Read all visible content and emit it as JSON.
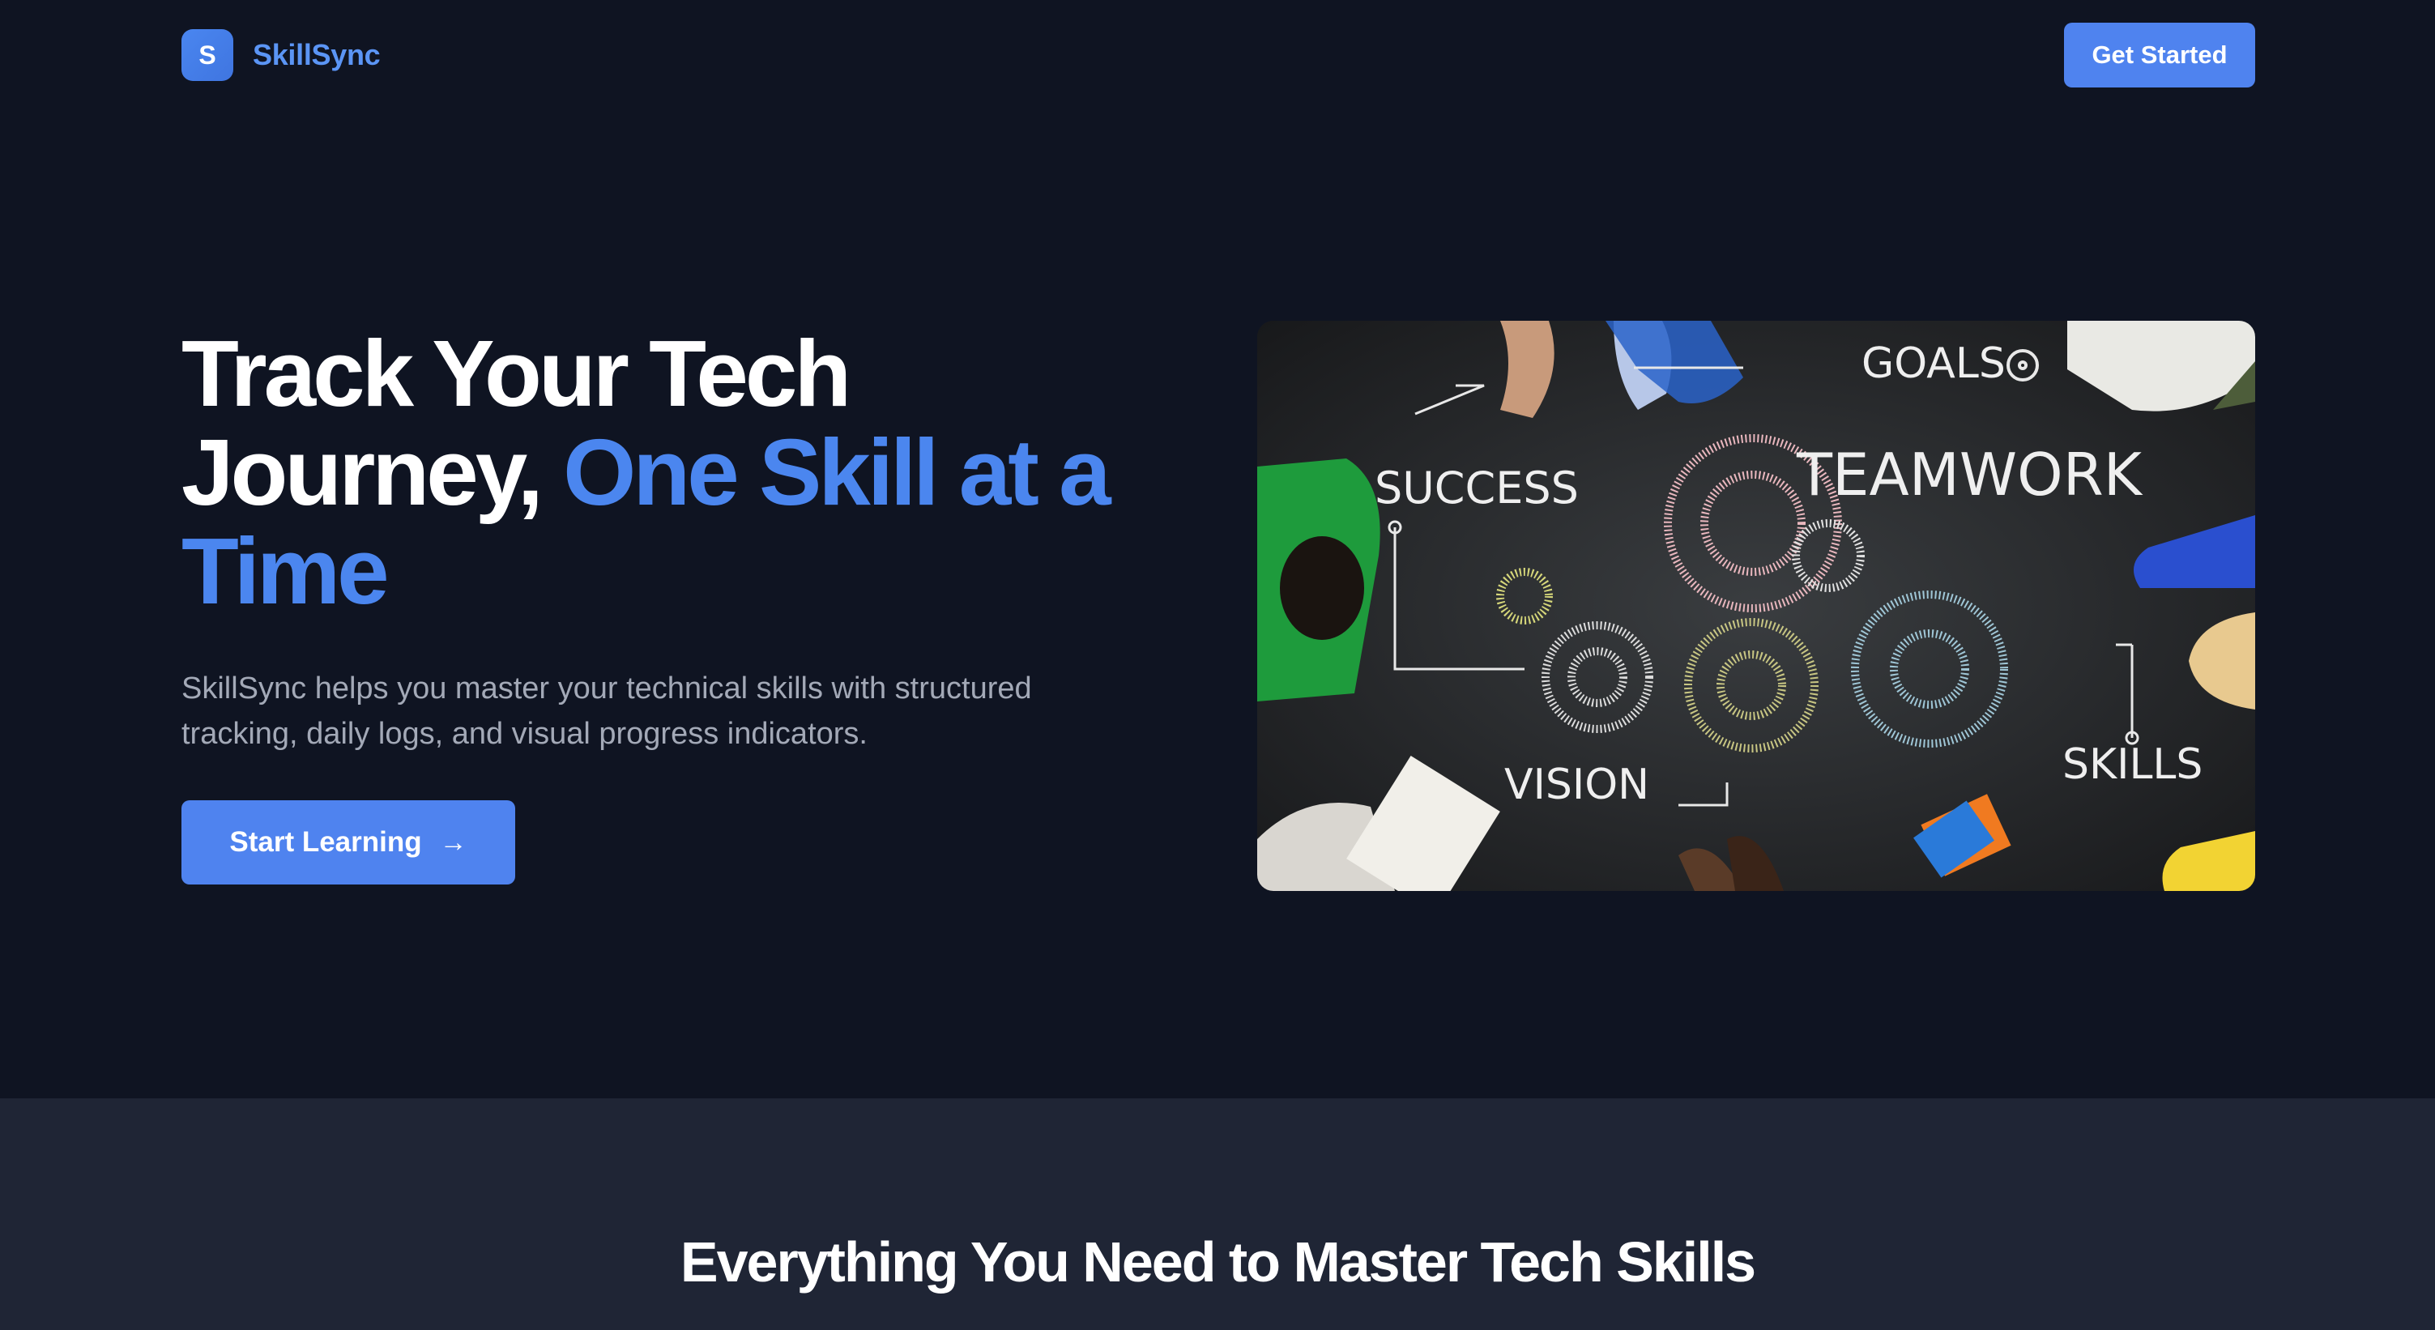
{
  "brand": {
    "logo_letter": "S",
    "name": "SkillSync"
  },
  "nav": {
    "cta_label": "Get Started"
  },
  "hero": {
    "title_line1": "Track Your Tech",
    "title_line2_plain": "Journey, ",
    "title_accent_a": "One Skill at a",
    "title_accent_b": "Time",
    "subtitle": "SkillSync helps you master your technical skills with structured tracking, daily logs, and visual progress indicators.",
    "cta_label": "Start Learning",
    "cta_icon": "arrow-right-icon",
    "image": {
      "words": {
        "goals": "GOALS",
        "success": "SUCCESS",
        "teamwork": "TEAMWORK",
        "vision": "VISION",
        "skills": "SKILLS"
      }
    }
  },
  "features": {
    "title": "Everything You Need to Master Tech Skills"
  },
  "colors": {
    "background": "#0f1422",
    "section_background": "#1f2535",
    "accent": "#4b86ef",
    "button": "#4f83ef",
    "muted_text": "#a3a9b7"
  }
}
